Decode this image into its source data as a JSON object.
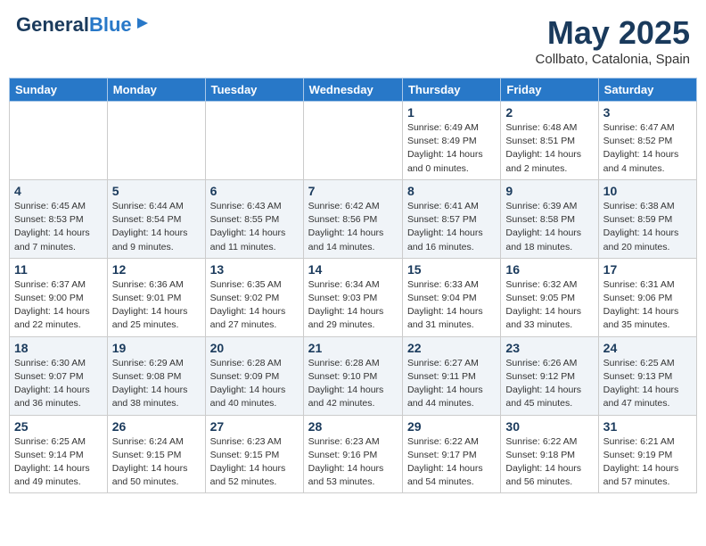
{
  "header": {
    "logo_line1": "General",
    "logo_line2": "Blue",
    "month_year": "May 2025",
    "location": "Collbato, Catalonia, Spain"
  },
  "days_of_week": [
    "Sunday",
    "Monday",
    "Tuesday",
    "Wednesday",
    "Thursday",
    "Friday",
    "Saturday"
  ],
  "weeks": [
    [
      {
        "day": "",
        "detail": ""
      },
      {
        "day": "",
        "detail": ""
      },
      {
        "day": "",
        "detail": ""
      },
      {
        "day": "",
        "detail": ""
      },
      {
        "day": "1",
        "detail": "Sunrise: 6:49 AM\nSunset: 8:49 PM\nDaylight: 14 hours and 0 minutes."
      },
      {
        "day": "2",
        "detail": "Sunrise: 6:48 AM\nSunset: 8:51 PM\nDaylight: 14 hours and 2 minutes."
      },
      {
        "day": "3",
        "detail": "Sunrise: 6:47 AM\nSunset: 8:52 PM\nDaylight: 14 hours and 4 minutes."
      }
    ],
    [
      {
        "day": "4",
        "detail": "Sunrise: 6:45 AM\nSunset: 8:53 PM\nDaylight: 14 hours and 7 minutes."
      },
      {
        "day": "5",
        "detail": "Sunrise: 6:44 AM\nSunset: 8:54 PM\nDaylight: 14 hours and 9 minutes."
      },
      {
        "day": "6",
        "detail": "Sunrise: 6:43 AM\nSunset: 8:55 PM\nDaylight: 14 hours and 11 minutes."
      },
      {
        "day": "7",
        "detail": "Sunrise: 6:42 AM\nSunset: 8:56 PM\nDaylight: 14 hours and 14 minutes."
      },
      {
        "day": "8",
        "detail": "Sunrise: 6:41 AM\nSunset: 8:57 PM\nDaylight: 14 hours and 16 minutes."
      },
      {
        "day": "9",
        "detail": "Sunrise: 6:39 AM\nSunset: 8:58 PM\nDaylight: 14 hours and 18 minutes."
      },
      {
        "day": "10",
        "detail": "Sunrise: 6:38 AM\nSunset: 8:59 PM\nDaylight: 14 hours and 20 minutes."
      }
    ],
    [
      {
        "day": "11",
        "detail": "Sunrise: 6:37 AM\nSunset: 9:00 PM\nDaylight: 14 hours and 22 minutes."
      },
      {
        "day": "12",
        "detail": "Sunrise: 6:36 AM\nSunset: 9:01 PM\nDaylight: 14 hours and 25 minutes."
      },
      {
        "day": "13",
        "detail": "Sunrise: 6:35 AM\nSunset: 9:02 PM\nDaylight: 14 hours and 27 minutes."
      },
      {
        "day": "14",
        "detail": "Sunrise: 6:34 AM\nSunset: 9:03 PM\nDaylight: 14 hours and 29 minutes."
      },
      {
        "day": "15",
        "detail": "Sunrise: 6:33 AM\nSunset: 9:04 PM\nDaylight: 14 hours and 31 minutes."
      },
      {
        "day": "16",
        "detail": "Sunrise: 6:32 AM\nSunset: 9:05 PM\nDaylight: 14 hours and 33 minutes."
      },
      {
        "day": "17",
        "detail": "Sunrise: 6:31 AM\nSunset: 9:06 PM\nDaylight: 14 hours and 35 minutes."
      }
    ],
    [
      {
        "day": "18",
        "detail": "Sunrise: 6:30 AM\nSunset: 9:07 PM\nDaylight: 14 hours and 36 minutes."
      },
      {
        "day": "19",
        "detail": "Sunrise: 6:29 AM\nSunset: 9:08 PM\nDaylight: 14 hours and 38 minutes."
      },
      {
        "day": "20",
        "detail": "Sunrise: 6:28 AM\nSunset: 9:09 PM\nDaylight: 14 hours and 40 minutes."
      },
      {
        "day": "21",
        "detail": "Sunrise: 6:28 AM\nSunset: 9:10 PM\nDaylight: 14 hours and 42 minutes."
      },
      {
        "day": "22",
        "detail": "Sunrise: 6:27 AM\nSunset: 9:11 PM\nDaylight: 14 hours and 44 minutes."
      },
      {
        "day": "23",
        "detail": "Sunrise: 6:26 AM\nSunset: 9:12 PM\nDaylight: 14 hours and 45 minutes."
      },
      {
        "day": "24",
        "detail": "Sunrise: 6:25 AM\nSunset: 9:13 PM\nDaylight: 14 hours and 47 minutes."
      }
    ],
    [
      {
        "day": "25",
        "detail": "Sunrise: 6:25 AM\nSunset: 9:14 PM\nDaylight: 14 hours and 49 minutes."
      },
      {
        "day": "26",
        "detail": "Sunrise: 6:24 AM\nSunset: 9:15 PM\nDaylight: 14 hours and 50 minutes."
      },
      {
        "day": "27",
        "detail": "Sunrise: 6:23 AM\nSunset: 9:15 PM\nDaylight: 14 hours and 52 minutes."
      },
      {
        "day": "28",
        "detail": "Sunrise: 6:23 AM\nSunset: 9:16 PM\nDaylight: 14 hours and 53 minutes."
      },
      {
        "day": "29",
        "detail": "Sunrise: 6:22 AM\nSunset: 9:17 PM\nDaylight: 14 hours and 54 minutes."
      },
      {
        "day": "30",
        "detail": "Sunrise: 6:22 AM\nSunset: 9:18 PM\nDaylight: 14 hours and 56 minutes."
      },
      {
        "day": "31",
        "detail": "Sunrise: 6:21 AM\nSunset: 9:19 PM\nDaylight: 14 hours and 57 minutes."
      }
    ]
  ]
}
